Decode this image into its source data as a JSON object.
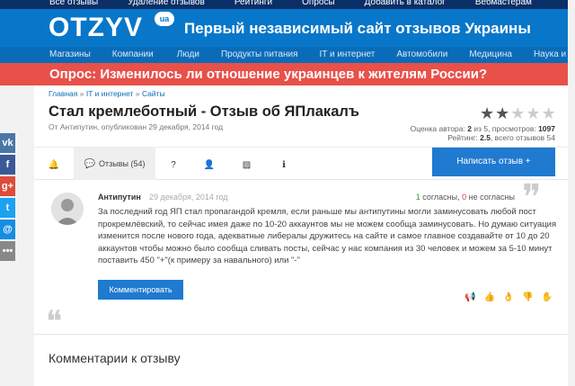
{
  "topbar": {
    "links": [
      "Все отзывы",
      "Удаление отзывов",
      "Рейтинги",
      "Опросы",
      "Добавить в каталог",
      "Вебмастерам"
    ]
  },
  "header": {
    "logo": "OTZYV",
    "logo_badge": "ua",
    "tagline": "Первый независимый сайт отзывов Украины"
  },
  "nav": {
    "items": [
      "Магазины",
      "Компании",
      "Люди",
      "Продукты питания",
      "IT и интернет",
      "Автомобили",
      "Медицина",
      "Наука и"
    ]
  },
  "poll": {
    "text": "Опрос: Изменилось ли отношение украинцев к жителям России?"
  },
  "social": {
    "items": [
      {
        "icon": "vk-icon",
        "glyph": "vk",
        "color": "#4a76a8"
      },
      {
        "icon": "facebook-icon",
        "glyph": "f",
        "color": "#3b5998"
      },
      {
        "icon": "google-plus-icon",
        "glyph": "g+",
        "color": "#dd4b39"
      },
      {
        "icon": "twitter-icon",
        "glyph": "t",
        "color": "#1da1f2"
      },
      {
        "icon": "mail-icon",
        "glyph": "@",
        "color": "#168de2"
      },
      {
        "icon": "more-icon",
        "glyph": "•••",
        "color": "#888888"
      }
    ]
  },
  "page": {
    "breadcrumb": [
      "Главная",
      "IT и интернет",
      "Сайты"
    ],
    "breadcrumb_sep": "»",
    "title": "Стал кремлеботный - Отзыв об ЯПлакалъ",
    "byline": "От Антипутин, опубликован 29 декабря, 2014 год",
    "stars": {
      "filled": 2,
      "total": 5
    },
    "rating_line1_a": "Оценка автора: ",
    "rating_line1_score": "2",
    "rating_line1_b": " из 5, просмотров: ",
    "rating_line1_views": "1097",
    "rating_line2_a": "Рейтинг: ",
    "rating_line2_score": "2.5",
    "rating_line2_b": ", всего отзывов 54"
  },
  "tabs": {
    "items": [
      {
        "name": "tab-news",
        "icon": "bell-icon",
        "glyph": "🔔"
      },
      {
        "name": "tab-reviews",
        "icon": "comments-icon",
        "glyph": "💬",
        "label": "Отзывы (54)"
      },
      {
        "name": "tab-faq",
        "icon": "question-icon",
        "glyph": "?"
      },
      {
        "name": "tab-people",
        "icon": "user-icon",
        "glyph": "👤"
      },
      {
        "name": "tab-photos",
        "icon": "image-icon",
        "glyph": "▨"
      },
      {
        "name": "tab-info",
        "icon": "info-icon",
        "glyph": "ℹ"
      }
    ],
    "write_button": "Написать отзыв +"
  },
  "review": {
    "author": "Антипутин",
    "date": "29 декабря, 2014 год",
    "agree_count": "1",
    "agree_label": " согласны, ",
    "disagree_count": "0",
    "disagree_label": " не согласны",
    "body": "За последний год ЯП стал пропагандой кремля, если раньше мы антипутины могли заминусовать любой пост прокремлёвский, то сейчас имея даже по 10-20 аккаунтов мы не можем сообща заминусовать. Но думаю ситуация изменится после нового года, адекватные либералы дружитесь на сайте и самое главное создавайте от 10 до 20 аккаунтов чтобы можно было сообща сливать посты, сейчас у нас компания из 30 человек и можем за 5-10 минут поставить 450 \"+\"(к примеру за навального) или \"-\"",
    "comment_button": "Комментировать",
    "actions": [
      {
        "icon": "megaphone-icon",
        "glyph": "📢"
      },
      {
        "icon": "thumbs-up-icon",
        "glyph": "👍"
      },
      {
        "icon": "agree-icon",
        "glyph": "👌"
      },
      {
        "icon": "thumbs-down-icon",
        "glyph": "👎"
      },
      {
        "icon": "disagree-icon",
        "glyph": "✋"
      }
    ]
  },
  "comments": {
    "title": "Комментарии к отзыву"
  }
}
